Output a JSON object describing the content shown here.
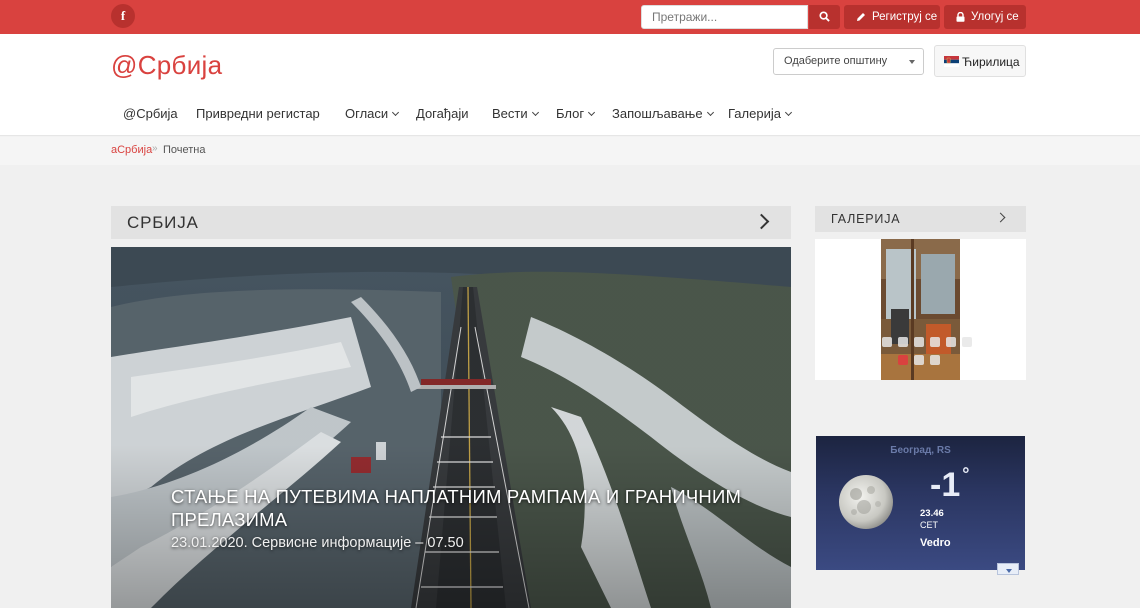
{
  "topbar": {
    "facebook_icon": "f",
    "search_placeholder": "Претражи...",
    "register_label": "Региструј се",
    "login_label": "Улогуј се"
  },
  "header": {
    "logo": "@Србија",
    "municipality_select": "Одаберите општину",
    "language": "Ћирилица"
  },
  "nav": {
    "items": [
      {
        "label": "@Србија"
      },
      {
        "label": "Привредни регистар"
      },
      {
        "label": "Огласи"
      },
      {
        "label": "Догађаји"
      },
      {
        "label": "Вести"
      },
      {
        "label": "Блог"
      },
      {
        "label": "Запошљавање"
      },
      {
        "label": "Галерија"
      }
    ]
  },
  "breadcrumb": {
    "home": "аСрбија",
    "separator": "»",
    "current": "Почетна"
  },
  "main": {
    "section_title": "СРБИЈА",
    "hero_title": "СТАЊЕ НА ПУТЕВИМА НАПЛАТНИМ РАМПАМА И ГРАНИЧНИМ ПРЕЛАЗИМА",
    "hero_meta": "23.01.2020. Сервисне информације – 07.50"
  },
  "gallery": {
    "title": "ГАЛЕРИЈА",
    "active_slide": 1
  },
  "weather": {
    "city": "Београд, RS",
    "temperature": "-1",
    "degree": "°",
    "time": "23.46",
    "day": "СЕТ",
    "condition": "Vedro"
  },
  "colors": {
    "brand": "#d9423f",
    "brand_dark": "#b8312e"
  }
}
